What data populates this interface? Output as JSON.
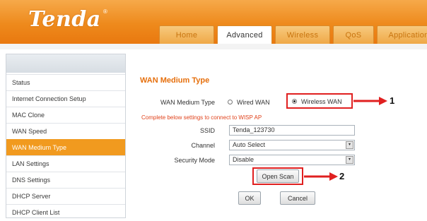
{
  "brand": {
    "logo": "Tenda",
    "registered": "®"
  },
  "tabs": [
    {
      "label": "Home"
    },
    {
      "label": "Advanced"
    },
    {
      "label": "Wireless"
    },
    {
      "label": "QoS"
    },
    {
      "label": "Application"
    }
  ],
  "sidebar": {
    "items": [
      {
        "label": "Status"
      },
      {
        "label": "Internet Connection Setup"
      },
      {
        "label": "MAC Clone"
      },
      {
        "label": "WAN Speed"
      },
      {
        "label": "WAN Medium Type"
      },
      {
        "label": "LAN Settings"
      },
      {
        "label": "DNS Settings"
      },
      {
        "label": "DHCP Server"
      },
      {
        "label": "DHCP Client List"
      }
    ]
  },
  "main": {
    "title": "WAN Medium Type",
    "medium_label": "WAN Medium Type",
    "wired_label": "Wired WAN",
    "wireless_label": "Wireless WAN",
    "hint": "Complete below settings to connect to WISP AP",
    "ssid_label": "SSID",
    "ssid_value": "Tenda_123730",
    "channel_label": "Channel",
    "channel_value": "Auto Select",
    "security_label": "Security Mode",
    "security_value": "Disable",
    "open_scan_label": "Open Scan",
    "ok_label": "OK",
    "cancel_label": "Cancel"
  },
  "callouts": {
    "marker1": "1",
    "marker2": "2"
  },
  "colors": {
    "brand_orange": "#ee8a1c",
    "active_item": "#f19a1f",
    "title": "#e66f0c",
    "hint": "#e0421b",
    "callout": "#e02020"
  }
}
